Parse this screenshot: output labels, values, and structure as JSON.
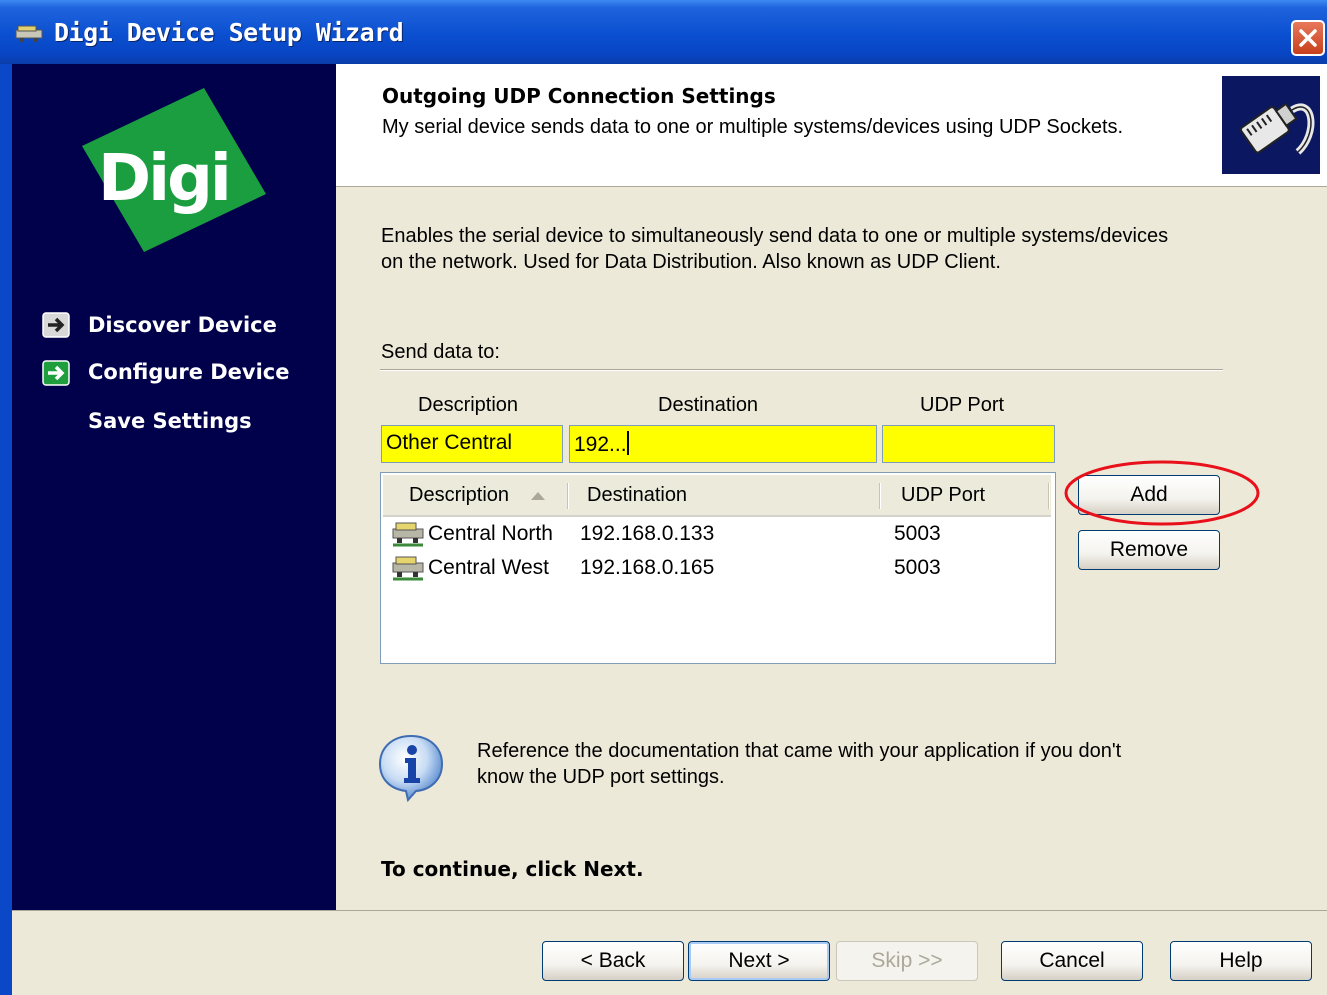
{
  "window": {
    "title": "Digi Device Setup Wizard",
    "icon": "network-device-icon",
    "close_icon": "close-icon"
  },
  "sidebar": {
    "logo_text": "Digi",
    "logo_color": "#1a9e3f",
    "items": [
      {
        "label": "Discover Device",
        "icon": "arrow-right-icon",
        "status": "done"
      },
      {
        "label": "Configure Device",
        "icon": "arrow-right-icon",
        "status": "current"
      },
      {
        "label": "Save Settings",
        "icon": "",
        "status": "pending"
      }
    ]
  },
  "header": {
    "title": "Outgoing UDP Connection Settings",
    "subtitle": "My serial device sends data to one or multiple systems/devices using UDP Sockets.",
    "icon": "network-plug-icon"
  },
  "content": {
    "description_line1": "Enables the serial device to simultaneously send data to one or multiple systems/devices",
    "description_line2": "on the network. Used for Data Distribution. Also known as UDP Client.",
    "send_label": "Send data to:",
    "input_headers": {
      "description": "Description",
      "destination": "Destination",
      "udp_port": "UDP Port"
    },
    "inputs": {
      "description": "Other Central",
      "destination": "192...",
      "udp_port": "",
      "highlight_color": "#ffff00"
    },
    "list": {
      "columns": [
        "Description",
        "Destination",
        "UDP Port"
      ],
      "sort_icon": "sort-ascending-icon",
      "rows": [
        {
          "icon": "network-device-icon",
          "description": "Central North",
          "destination": "192.168.0.133",
          "udp_port": "5003"
        },
        {
          "icon": "network-device-icon",
          "description": "Central West",
          "destination": "192.168.0.165",
          "udp_port": "5003"
        }
      ]
    },
    "add_label": "Add",
    "remove_label": "Remove",
    "add_highlight": "red-circle-annotation",
    "info_icon": "info-icon",
    "info_line1": "Reference the documentation that came with your application if you don't",
    "info_line2": "know the UDP port settings.",
    "continue_text": "To continue, click Next."
  },
  "footer": {
    "back_label": "Back",
    "next_label": "Next",
    "skip_label": "Skip >>",
    "cancel_label": "Cancel",
    "help_label": "Help"
  }
}
